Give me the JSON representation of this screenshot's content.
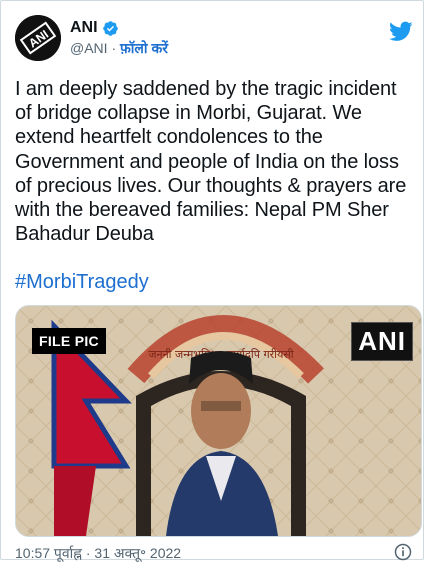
{
  "tweet": {
    "display_name": "ANI",
    "handle": "@ANI",
    "separator": "·",
    "follow_label": "फ़ॉलो करें",
    "text": "I am deeply saddened by the tragic incident\nof bridge collapse in Morbi, Gujarat. We\nextend heartfelt condolences to the\nGovernment and people of India on the loss\nof precious lives. Our thoughts & prayers are\nwith the bereaved families: Nepal PM Sher\nBahadur Deuba",
    "hashtag": "#MorbiTragedy",
    "timestamp": "10:57 पूर्वाह्न · 31 अक्तू॰ 2022"
  },
  "media": {
    "file_pic_label": "FILE PIC",
    "watermark": "ANI",
    "emblem_text": "जननी जन्मभूमिश्च स्वर्गादपि गरीयसी"
  },
  "colors": {
    "accent": "#1d6fd0",
    "twitter_blue": "#1d9bf0",
    "text": "#0f1419",
    "muted": "#536471"
  },
  "icons": {
    "verified": "verified-badge-icon",
    "brand": "twitter-bird-icon",
    "info": "info-icon"
  }
}
